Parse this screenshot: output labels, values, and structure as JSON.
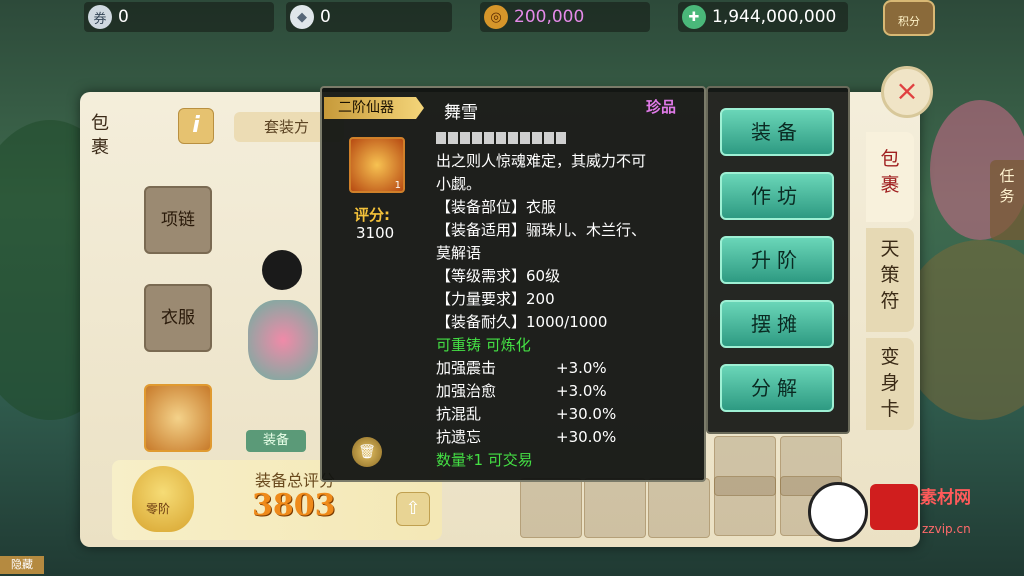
{
  "resources": {
    "r1_value": "0",
    "r2_value": "0",
    "coins_value": "200,000",
    "gems_value": "1,944,000,000",
    "score_button": "积分"
  },
  "bag": {
    "title": "包裹",
    "info_glyph": "i",
    "set_tab_label": "套装方",
    "slots": {
      "necklace": "项链",
      "clothes": "衣服"
    },
    "equip_tab": "装备",
    "rank_label": "零阶",
    "total_score_label": "装备总评分",
    "total_score_value": "3803"
  },
  "tooltip": {
    "grade": "二阶仙器",
    "name": "舞雪",
    "rarity": "珍品",
    "score_label": "评分:",
    "score_value": "3100",
    "icon_badge": "1",
    "lines": [
      "出之则人惊魂难定，其威力不可",
      "小觑。",
      "【装备部位】衣服",
      "【装备适用】骊珠儿、木兰行、",
      "莫解语",
      "【等级需求】60级",
      "【力量要求】200",
      "【装备耐久】1000/1000"
    ],
    "tradeable_line": "可重铸 可炼化",
    "stats": [
      {
        "k": "加强震击",
        "v": "+3.0%"
      },
      {
        "k": "加强治愈",
        "v": "+3.0%"
      },
      {
        "k": "抗混乱",
        "v": "+30.0%"
      },
      {
        "k": "抗遗忘",
        "v": "+30.0%"
      }
    ],
    "quantity_line": "数量*1 可交易"
  },
  "actions": [
    "装备",
    "作坊",
    "升阶",
    "摆摊",
    "分解"
  ],
  "side_tabs": [
    "包裹",
    "天策符",
    "变身卡"
  ],
  "task_tab": "任务",
  "close_glyph": "×",
  "watermark": {
    "line1": "素材网",
    "line2": "zzvip.cn"
  },
  "chat_button": "隐藏",
  "colors": {
    "accent": "#3cc2a0",
    "rare": "#e07ae8",
    "gold": "#f4c23a",
    "green": "#44e044"
  }
}
